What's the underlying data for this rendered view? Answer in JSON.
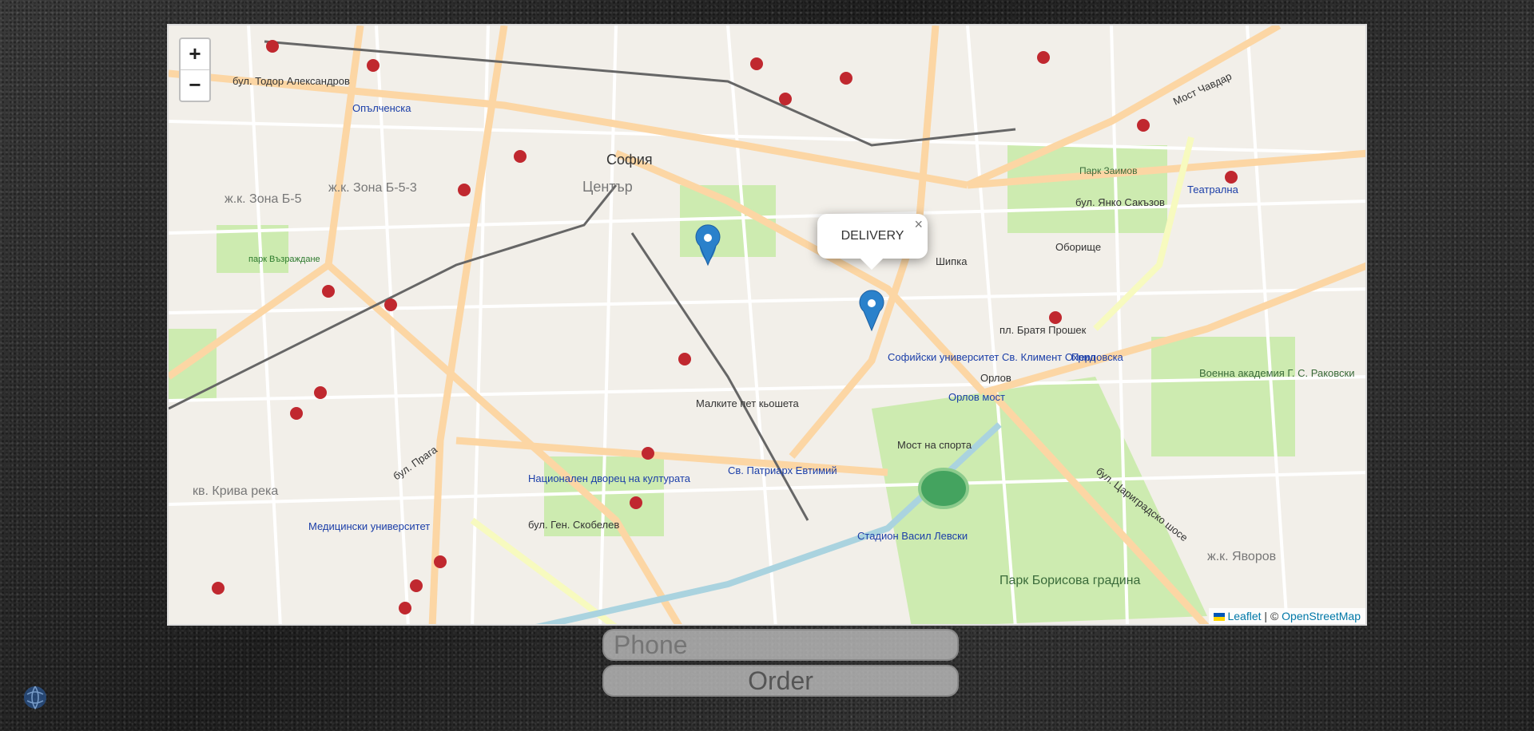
{
  "map": {
    "zoom_in": "+",
    "zoom_out": "−",
    "popup_text": "DELIVERY",
    "popup_close": "×",
    "attribution": {
      "leaflet": "Leaflet",
      "separator": "| ©",
      "osm": "OpenStreetMap"
    },
    "labels": {
      "sofia": "София",
      "center": "Център",
      "zona_b53": "ж.к. Зона Б-5-3",
      "zona_b5": "ж.к. Зона Б-5",
      "opalchenska": "Опълченска",
      "park_vazrazhdane": "парк Възраждане",
      "kriva_reka": "кв. Крива река",
      "med_univ": "Медицински университет",
      "ndk": "Национален дворец на културата",
      "patriarh": "Св. Патриарх Евтимий",
      "malkite": "Малките пет кьошета",
      "univ": "Софийски университет Св. Климент Охрид",
      "orlov": "Орлов мост",
      "orlov_label": "Орлов",
      "most_sport": "Мост на спорта",
      "stadion": "Стадион Васил Левски",
      "park_boris": "Парк Борисова градина",
      "bratya": "пл. Братя Прошек",
      "voenna": "Военна академия Г. С. Раковски",
      "park_zaimov": "Парк Заимов",
      "teatralna": "Театрална",
      "yavorov": "ж.к. Яворов",
      "bul_todor": "бул. Тодор Александров",
      "bul_yanko": "бул. Янко Сакъзов",
      "bul_tsarigr": "бул. Цариградско шосе",
      "bul_praga": "бул. Прага",
      "bul_skobelev": "бул. Ген. Скобелев",
      "perlovska": "Перловска",
      "shipka": "Шипка",
      "oborishte": "Оборище",
      "most_chavdar": "Мост Чавдар"
    }
  },
  "form": {
    "phone_placeholder": "Phone",
    "order_label": "Order"
  }
}
